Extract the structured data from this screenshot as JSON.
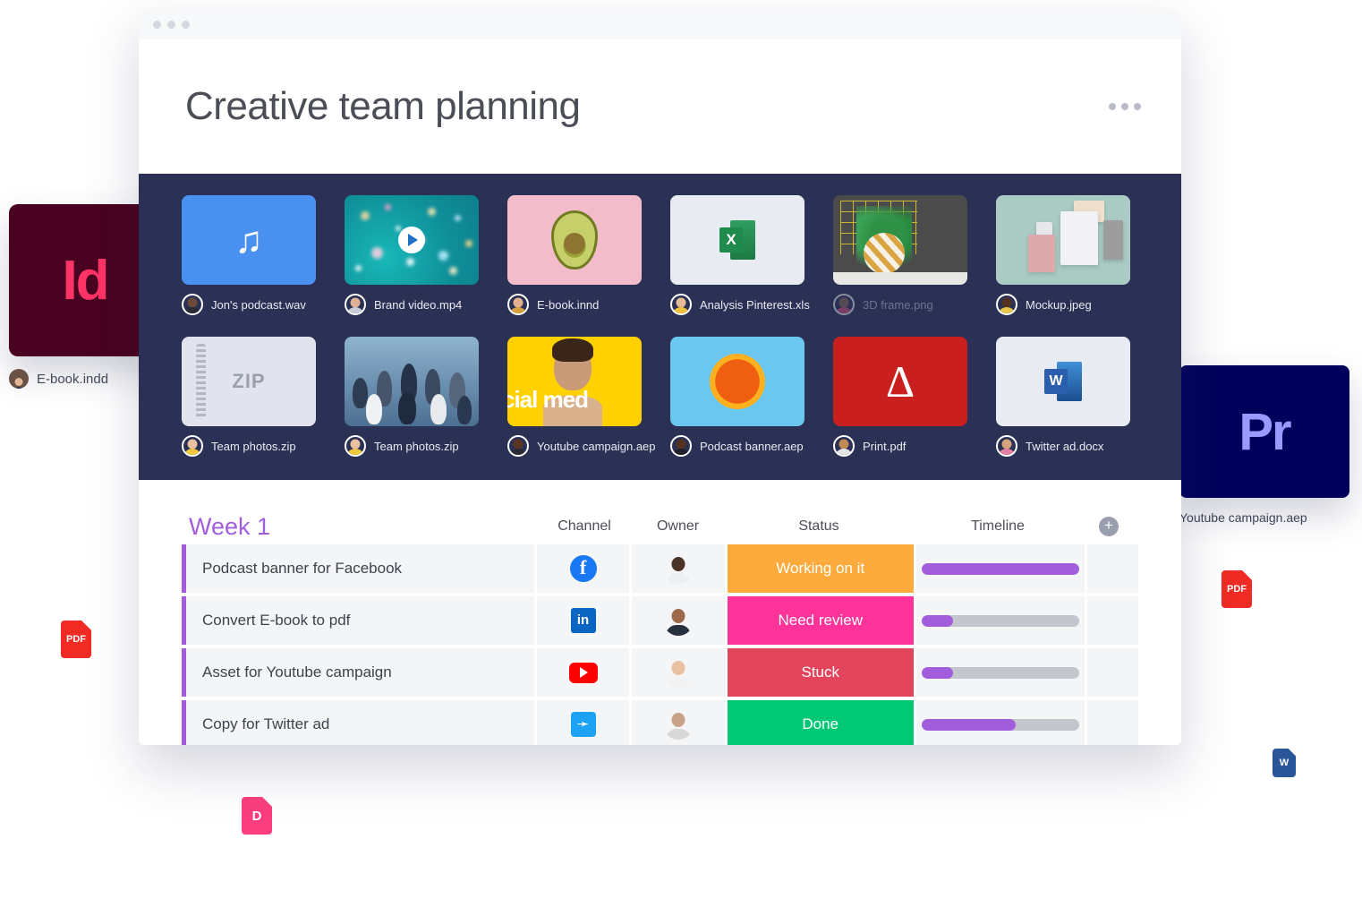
{
  "window": {
    "title": "Creative team planning",
    "menu_icon": "kebab-menu-icon"
  },
  "board": {
    "files": [
      {
        "name": "Jon's podcast.wav",
        "art": "music",
        "dim": false,
        "avatar_face": "#6b4a3a",
        "avatar_body": "#2b2b34"
      },
      {
        "name": "Brand video.mp4",
        "art": "video",
        "dim": false,
        "avatar_face": "#e0b295",
        "avatar_body": "#c8ccd6"
      },
      {
        "name": "E-book.innd",
        "art": "avocado",
        "dim": false,
        "avatar_face": "#e2b08f",
        "avatar_body": "#d8a13f"
      },
      {
        "name": "Analysis Pinterest.xls",
        "art": "xls",
        "dim": false,
        "avatar_face": "#e7bb96",
        "avatar_body": "#f0c23a"
      },
      {
        "name": "3D frame.png",
        "art": "3d",
        "dim": true,
        "avatar_face": "#8b6a55",
        "avatar_body": "#d84f7a"
      },
      {
        "name": "Mockup.jpeg",
        "art": "mockup",
        "dim": false,
        "avatar_face": "#53331f",
        "avatar_body": "#e7c44a"
      },
      {
        "name": "Team photos.zip",
        "art": "zip",
        "dim": false,
        "avatar_face": "#e9c0a0",
        "avatar_body": "#f1c93d"
      },
      {
        "name": "Team photos.zip",
        "art": "team",
        "dim": false,
        "avatar_face": "#e9c0a0",
        "avatar_body": "#f1c93d"
      },
      {
        "name": "Youtube campaign.aep",
        "art": "yellow",
        "dim": false,
        "avatar_face": "#5b3723",
        "avatar_body": "#2b2b34"
      },
      {
        "name": "Podcast banner.aep",
        "art": "orange",
        "dim": false,
        "avatar_face": "#53331f",
        "avatar_body": "#20202a"
      },
      {
        "name": "Print.pdf",
        "art": "pdf",
        "dim": false,
        "avatar_face": "#c08a52",
        "avatar_body": "#e5e5e5"
      },
      {
        "name": "Twitter ad.docx",
        "art": "docx",
        "dim": false,
        "avatar_face": "#d4a27c",
        "avatar_body": "#e77fa6"
      }
    ]
  },
  "table": {
    "group_title": "Week 1",
    "columns": {
      "channel": "Channel",
      "owner": "Owner",
      "status": "Status",
      "timeline": "Timeline"
    },
    "add_column_icon": "plus-circle-icon",
    "accent": "#a25ddc",
    "rows": [
      {
        "task": "Podcast banner for Facebook",
        "channel": "facebook-icon",
        "owner_face": "#4a3224",
        "owner_body": "#eceff3",
        "status": "Working on it",
        "status_color": "#fdab3d",
        "progress": 100
      },
      {
        "task": "Convert E-book to pdf",
        "channel": "linkedin-icon",
        "owner_face": "#9d6a49",
        "owner_body": "#26303f",
        "status": "Need review",
        "status_color": "#ff3399",
        "progress": 20
      },
      {
        "task": "Asset for Youtube campaign",
        "channel": "youtube-icon",
        "owner_face": "#e9c0a0",
        "owner_body": "#f2f2f2",
        "status": "Stuck",
        "status_color": "#e2445c",
        "progress": 20
      },
      {
        "task": "Copy for Twitter ad",
        "channel": "twitter-icon",
        "owner_face": "#caa288",
        "owner_body": "#d8d8d8",
        "status": "Done",
        "status_color": "#00c875",
        "progress": 60
      }
    ],
    "bar_color": "#a martinez"
  },
  "floating": {
    "indesign": {
      "glyph": "Id",
      "label": "E-book.indd",
      "color": "#49021f",
      "glyph_color": "#ff3366"
    },
    "premiere": {
      "glyph": "Pr",
      "label": "Youtube campaign.aep",
      "color": "#00005b",
      "glyph_color": "#9999ff"
    },
    "badges": [
      {
        "name": "pdf-file-badge",
        "label": "PDF",
        "color": "#ef2b24"
      },
      {
        "name": "pdf-file-badge",
        "label": "PDF",
        "color": "#ef2b24"
      },
      {
        "name": "dropbox-file-badge",
        "label": "D",
        "color": "#fc3e7e"
      },
      {
        "name": "word-file-badge",
        "label": "W",
        "color": "#2a5699"
      }
    ]
  }
}
